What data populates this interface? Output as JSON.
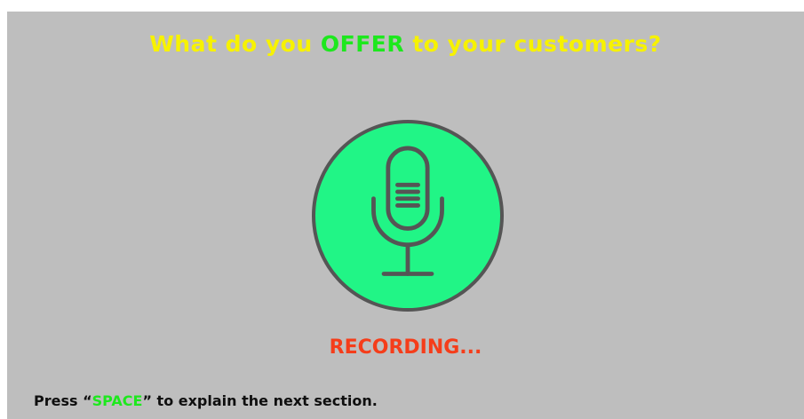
{
  "question": {
    "before": "What do you ",
    "highlight": "OFFER",
    "after": " to your customers?",
    "color": "#f7f200",
    "highlight_color": "#1de81d"
  },
  "mic": {
    "icon": "microphone-icon",
    "fill_color": "#21f586",
    "stroke_color": "#555555"
  },
  "status": {
    "label": "RECORDING...",
    "color": "#f53d1a"
  },
  "hint": {
    "before": "Press “",
    "key": "SPACE",
    "after": "” to explain the next section.",
    "key_color": "#1de81d"
  }
}
